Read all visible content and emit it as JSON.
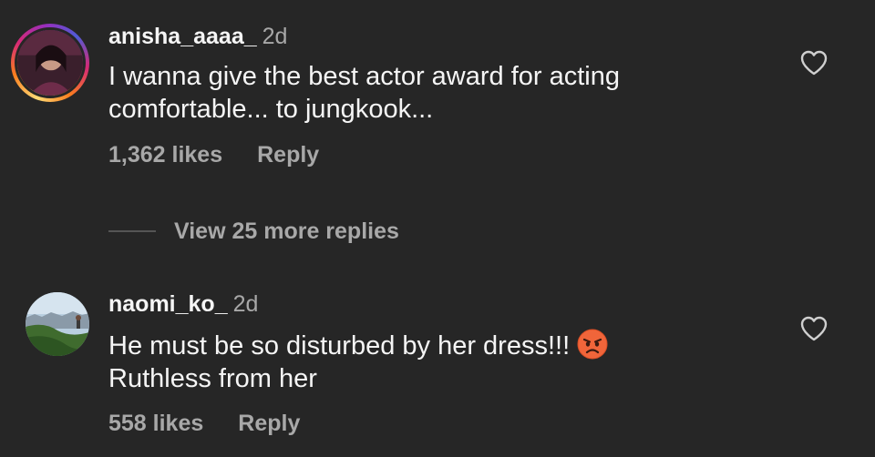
{
  "comments": [
    {
      "username": "anisha_aaaa_",
      "time": "2d",
      "lines": [
        "I wanna give the best actor award for acting",
        "comfortable... to jungkook..."
      ],
      "likes": "1,362 likes",
      "reply": "Reply",
      "has_story_ring": true,
      "view_replies": "View 25 more replies"
    },
    {
      "username": "naomi_ko_",
      "time": "2d",
      "lines": [
        "He must be so disturbed by her dress!!!",
        "Ruthless from her"
      ],
      "emoji": "angry-face",
      "likes": "558 likes",
      "reply": "Reply",
      "has_story_ring": false
    }
  ],
  "colors": {
    "background": "#262626",
    "primary_text": "#f5f5f5",
    "secondary_text": "#a8a8a8"
  },
  "icons": {
    "like": "heart-outline-icon"
  }
}
